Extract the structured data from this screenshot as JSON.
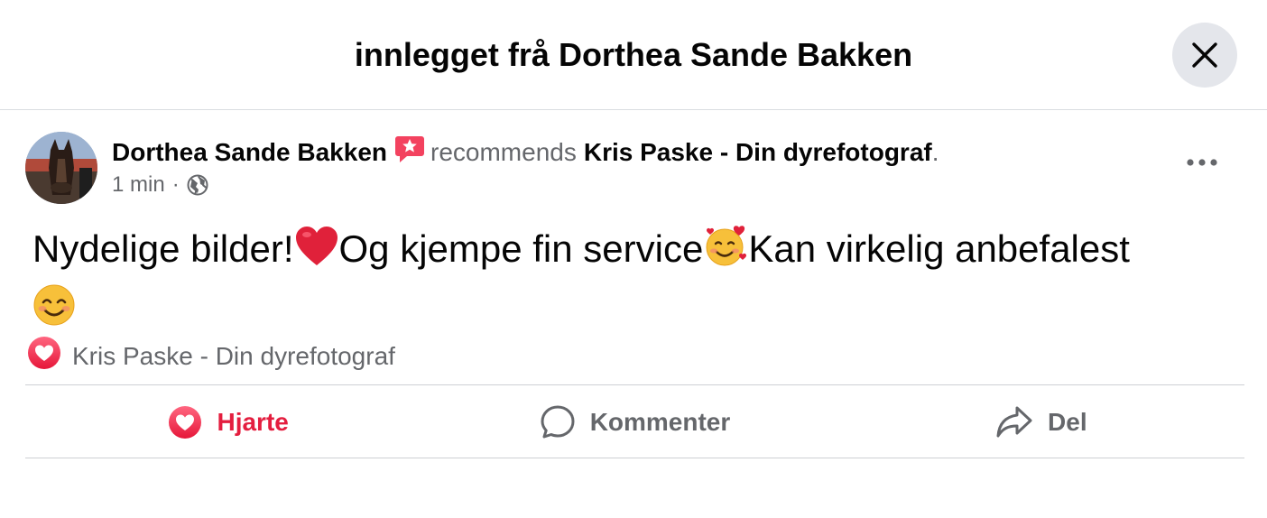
{
  "dialog": {
    "title": "innlegget frå Dorthea Sande Bakken",
    "close_icon": "close-icon"
  },
  "post": {
    "author": "Dorthea Sande Bakken",
    "recommend_icon": "recommendation-icon",
    "recommends_text": "recommends",
    "page_name": "Kris Paske - Din dyrefotograf",
    "page_name_suffix": ".",
    "time": "1 min",
    "separator": "·",
    "privacy_icon": "globe-icon",
    "more_icon": "more-options-icon",
    "body_part1": "Nydelige bilder!",
    "body_part2": "Og kjempe fin service",
    "body_part3": "Kan virkelig anbefalest",
    "emojis": [
      "heart-emoji",
      "smiling-face-with-hearts-emoji",
      "smiling-face-emoji"
    ]
  },
  "reactions": {
    "icon": "heart-reaction-icon",
    "reactor": "Kris Paske - Din dyrefotograf"
  },
  "actions": {
    "love_label": "Hjarte",
    "comment_label": "Kommenter",
    "share_label": "Del"
  },
  "colors": {
    "love_red": "#e41e3f",
    "secondary_text": "#65676b",
    "close_bg": "#e4e6eb"
  }
}
